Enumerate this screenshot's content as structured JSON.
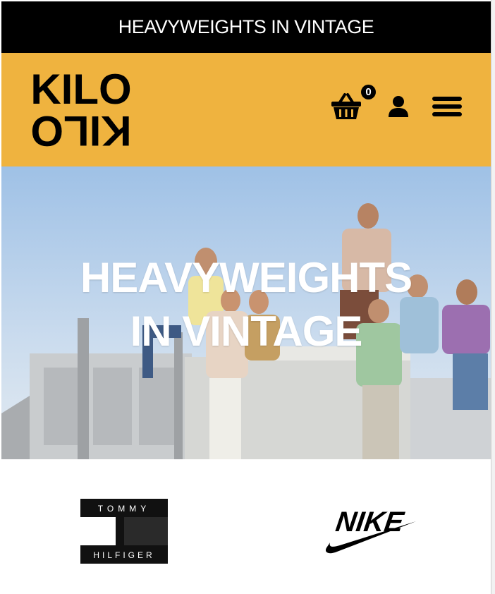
{
  "announcement": {
    "text": "HEAVYWEIGHTS IN VINTAGE"
  },
  "header": {
    "logo_text": "KILO",
    "cart_count": "0",
    "background_color": "#efb33f"
  },
  "hero": {
    "title_line1": "HEAVYWEIGHTS",
    "title_line2": "IN VINTAGE"
  },
  "brands": [
    {
      "name": "TOMMY HILFIGER",
      "line1": "TOMMY",
      "line2": "HILFIGER"
    },
    {
      "name": "NIKE"
    }
  ],
  "icons": [
    "cart-icon",
    "account-icon",
    "menu-icon"
  ]
}
